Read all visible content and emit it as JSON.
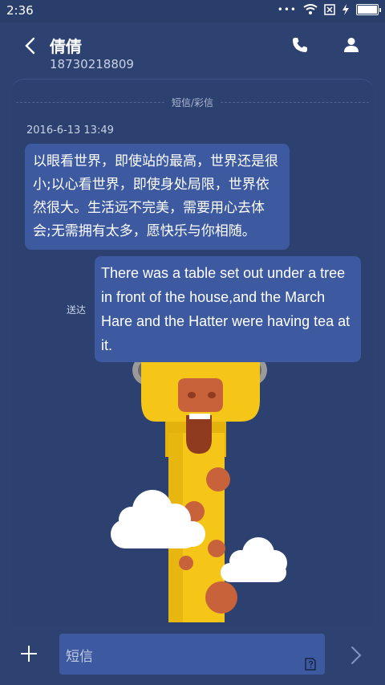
{
  "status_bar": {
    "time": "2:36",
    "dots": "•••",
    "icons": [
      "wifi-icon",
      "sim-blocked-icon",
      "charging-icon",
      "battery-icon"
    ]
  },
  "header": {
    "contact_name": "倩倩",
    "contact_number": "18730218809",
    "icons": [
      "back-arrow-icon",
      "phone-icon",
      "person-icon"
    ]
  },
  "conversation": {
    "channel_label": "短信/彩信",
    "timestamp": "2016-6-13 13:49",
    "received_message": "以眼看世界，即使站的最高，世界还是很小;以心看世界，即使身处局限，世界依然很大。生活远不完美，需要用心去体会;无需拥有太多，愿快乐与你相随。",
    "sent_message": "There was a table set out under a tree in front of the house,and the March Hare and the Hatter were having tea at it.",
    "sent_status": "送达"
  },
  "composer": {
    "placeholder": "短信",
    "icons": [
      "plus-icon",
      "sim-card-icon",
      "send-arrow-icon"
    ]
  },
  "colors": {
    "background": "#2d4271",
    "bubble": "#3d5aa0",
    "giraffe_yellow": "#f5c518",
    "giraffe_spot": "#c8623a"
  }
}
